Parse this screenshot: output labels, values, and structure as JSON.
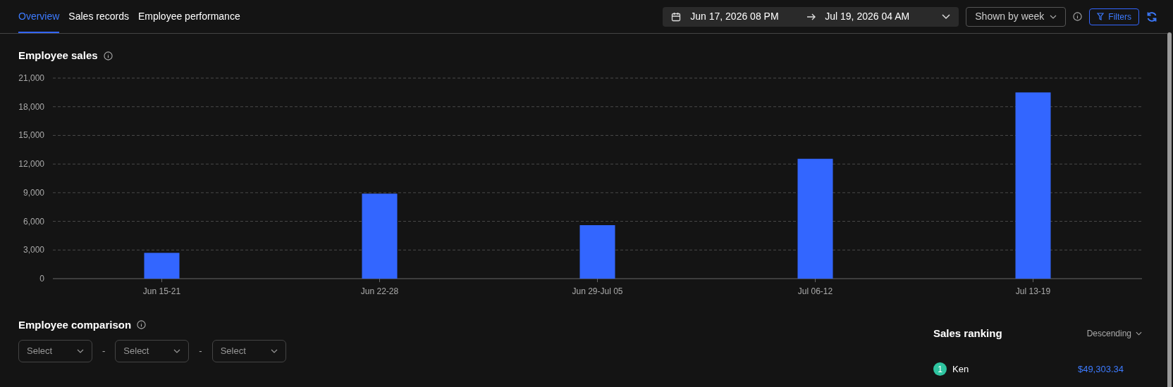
{
  "tabs": [
    {
      "label": "Overview",
      "selected": true
    },
    {
      "label": "Sales records",
      "selected": false
    },
    {
      "label": "Employee performance",
      "selected": false
    }
  ],
  "date_range": {
    "start": "Jun 17, 2026 08 PM",
    "end": "Jul 19, 2026 04 AM"
  },
  "grouping": {
    "value": "Shown by week"
  },
  "filters_button": "Filters",
  "employee_sales": {
    "title": "Employee sales",
    "chart_data": {
      "type": "bar",
      "categories": [
        "Jun 15-21",
        "Jun 22-28",
        "Jun 29-Jul 05",
        "Jul 06-12",
        "Jul 13-19"
      ],
      "grid": true,
      "series": [
        {
          "color": "#3366ff",
          "values": [
            2700,
            8900,
            5600,
            12550,
            19500
          ]
        }
      ],
      "ylim": [
        0,
        21000
      ],
      "yticks": [
        {
          "value": 0,
          "label": "0"
        },
        {
          "value": 3000,
          "label": "3,000"
        },
        {
          "value": 6000,
          "label": "6,000"
        },
        {
          "value": 9000,
          "label": "9,000"
        },
        {
          "value": 12000,
          "label": "12,000"
        },
        {
          "value": 15000,
          "label": "15,000"
        },
        {
          "value": 18000,
          "label": "18,000"
        },
        {
          "value": 21000,
          "label": "21,000"
        }
      ]
    }
  },
  "employee_comparison": {
    "title": "Employee comparison",
    "selects": [
      {
        "placeholder": "Select"
      },
      {
        "placeholder": "Select"
      },
      {
        "placeholder": "Select"
      }
    ],
    "separators": [
      "-",
      "-"
    ]
  },
  "sales_ranking": {
    "title": "Sales ranking",
    "sort": "Descending",
    "rows": [
      {
        "rank": "1",
        "name": "Ken",
        "amount": "$49,303.34"
      }
    ]
  }
}
